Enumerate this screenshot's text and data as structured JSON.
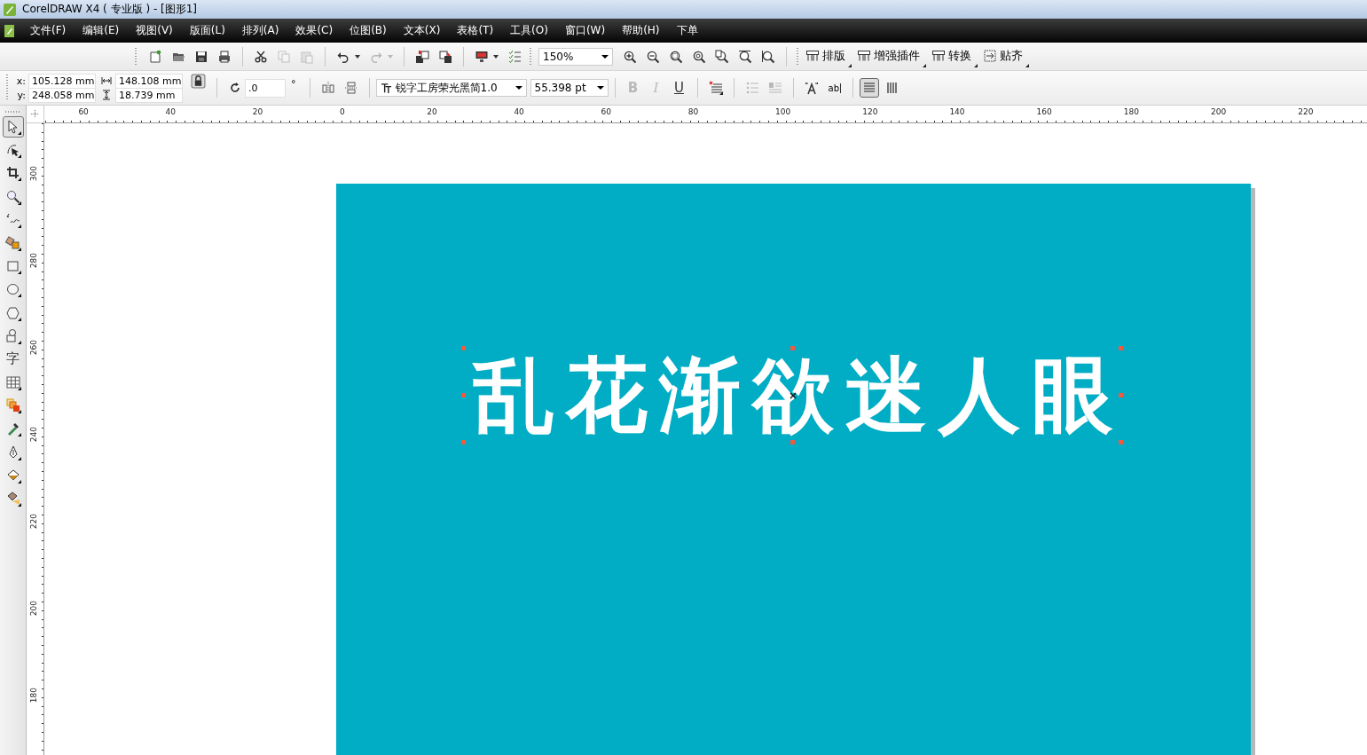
{
  "window": {
    "title": "CorelDRAW X4 ( 专业版 ) - [图形1]"
  },
  "menu": [
    "文件(F)",
    "编辑(E)",
    "视图(V)",
    "版面(L)",
    "排列(A)",
    "效果(C)",
    "位图(B)",
    "文本(X)",
    "表格(T)",
    "工具(O)",
    "窗口(W)",
    "帮助(H)",
    "下单"
  ],
  "toolbar": {
    "groups": [
      {
        "buttons": [
          {
            "kind": "new",
            "disabled": false,
            "menu": false
          },
          {
            "kind": "open",
            "disabled": false,
            "menu": false
          },
          {
            "kind": "save",
            "disabled": false,
            "menu": false
          },
          {
            "kind": "print",
            "disabled": false,
            "menu": false
          }
        ]
      },
      {
        "buttons": [
          {
            "kind": "cut",
            "disabled": false,
            "menu": false
          },
          {
            "kind": "copy",
            "disabled": true,
            "menu": false
          },
          {
            "kind": "paste",
            "disabled": true,
            "menu": false
          }
        ]
      },
      {
        "buttons": [
          {
            "kind": "undo",
            "disabled": false,
            "menu": true
          },
          {
            "kind": "redo",
            "disabled": true,
            "menu": true
          }
        ]
      },
      {
        "buttons": [
          {
            "kind": "import",
            "disabled": false,
            "menu": false
          },
          {
            "kind": "export",
            "disabled": false,
            "menu": false
          }
        ]
      },
      {
        "buttons": [
          {
            "kind": "launcher",
            "disabled": false,
            "menu": true
          },
          {
            "kind": "options",
            "disabled": false,
            "menu": false
          }
        ]
      }
    ],
    "zoom": "150%",
    "zoom_buttons": [
      {
        "kind": "zoom-in"
      },
      {
        "kind": "zoom-out"
      },
      {
        "kind": "zoom-selected"
      },
      {
        "kind": "zoom-all"
      },
      {
        "kind": "zoom-page"
      },
      {
        "kind": "zoom-width"
      },
      {
        "kind": "zoom-height"
      }
    ],
    "plugins": [
      {
        "label": "排版"
      },
      {
        "label": "增强插件"
      },
      {
        "label": "转换"
      },
      {
        "label": "贴齐",
        "kind": "snap"
      }
    ]
  },
  "property_bar": {
    "x_label": "x:",
    "x": "105.128 mm",
    "y_label": "y:",
    "y": "248.058 mm",
    "width": "148.108 mm",
    "height": "18.739 mm",
    "rotation": ".0",
    "degree": "°",
    "font": "锐字工房荣光黑简1.0",
    "font_size": "55.398 pt",
    "styles": [
      {
        "label": "B",
        "disabled": true
      },
      {
        "label": "I",
        "disabled": true
      },
      {
        "label": "U",
        "disabled": false
      }
    ],
    "paragraph_buttons": [
      {
        "kind": "bullets",
        "disabled": true
      },
      {
        "kind": "drop-cap",
        "disabled": true
      }
    ],
    "edit_text_label": "ab",
    "text_direction": [
      {
        "kind": "horizontal",
        "selected": true
      },
      {
        "kind": "vertical",
        "selected": false
      }
    ]
  },
  "toolbox": [
    {
      "kind": "pointer",
      "selected": true
    },
    {
      "kind": "shape",
      "selected": false
    },
    {
      "kind": "crop",
      "selected": false
    },
    {
      "kind": "zoom",
      "selected": false
    },
    {
      "kind": "freehand",
      "selected": false
    },
    {
      "kind": "smart-fill",
      "selected": false
    },
    {
      "kind": "rectangle",
      "selected": false
    },
    {
      "kind": "ellipse",
      "selected": false
    },
    {
      "kind": "polygon",
      "selected": false
    },
    {
      "kind": "basic-shapes",
      "selected": false
    },
    {
      "kind": "text",
      "selected": false,
      "label": "字"
    },
    {
      "kind": "table",
      "selected": false
    },
    {
      "kind": "blend",
      "selected": false
    },
    {
      "kind": "eyedropper",
      "selected": false
    },
    {
      "kind": "outline",
      "selected": false
    },
    {
      "kind": "fill",
      "selected": false
    },
    {
      "kind": "interactive-fill",
      "selected": false
    }
  ],
  "rulers": {
    "horizontal": [
      "60",
      "40",
      "20",
      "0",
      "20",
      "40",
      "60",
      "80",
      "100",
      "120",
      "140",
      "160",
      "180",
      "200",
      "220"
    ],
    "vertical": [
      "300",
      "280",
      "260",
      "240",
      "220",
      "200",
      "180"
    ]
  },
  "canvas": {
    "text": "乱花渐欲迷人眼",
    "selected": true
  }
}
